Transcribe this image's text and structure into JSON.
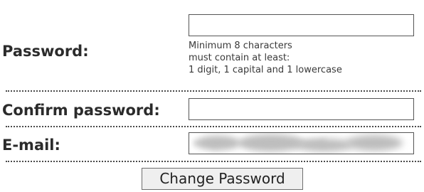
{
  "form": {
    "password": {
      "label": "Password:",
      "value": "",
      "hint_lines": [
        "Minimum 8 characters",
        "must contain at least:",
        "1 digit, 1 capital and 1 lowercase"
      ]
    },
    "confirm_password": {
      "label": "Confirm password:",
      "value": ""
    },
    "email": {
      "label": "E-mail:",
      "value": "•••c••••••••••••i••••l",
      "obscured": true
    },
    "submit_label": "Change Password"
  }
}
